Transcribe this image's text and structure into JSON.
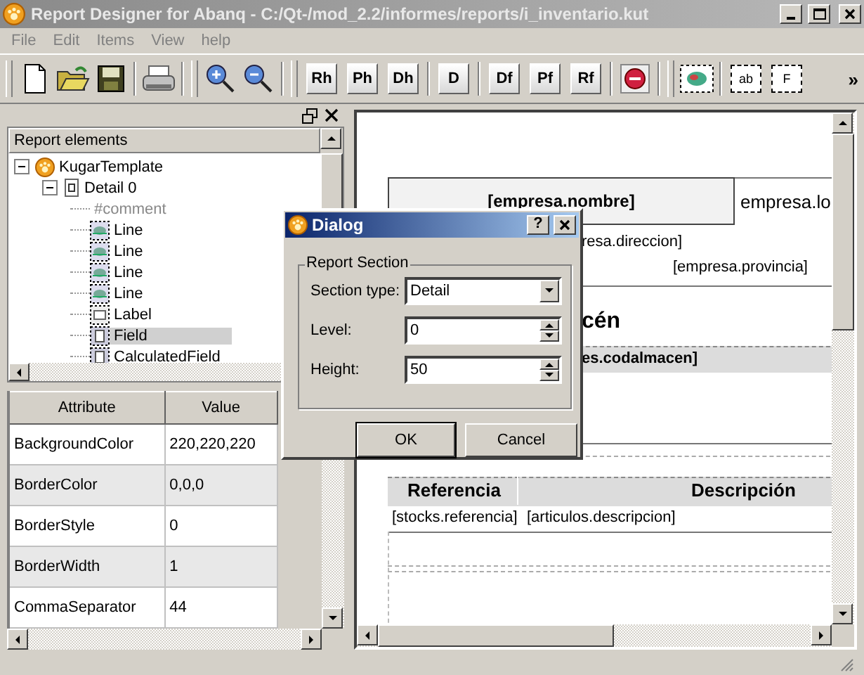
{
  "window": {
    "title": "Report Designer for Abanq - C:/Qt-/mod_2.2/informes/reports/i_inventario.kut"
  },
  "menu": [
    "File",
    "Edit",
    "Items",
    "View",
    "help"
  ],
  "toolbar": {
    "section_groups": [
      [
        "Rh",
        "Ph",
        "Dh"
      ],
      [
        "D"
      ],
      [
        "Df",
        "Pf",
        "Rf"
      ]
    ],
    "item_buttons": [
      "ab",
      "F"
    ],
    "overflow": "»"
  },
  "tree": {
    "header": "Report elements",
    "items": [
      {
        "label": "KugarTemplate",
        "kind": "template",
        "expanded": true,
        "selected": false,
        "children": [
          {
            "label": "Detail 0",
            "kind": "section",
            "expanded": true,
            "selected": false,
            "children": [
              {
                "label": "#comment",
                "kind": "comment",
                "selected": false
              },
              {
                "label": "Line",
                "kind": "line",
                "selected": false
              },
              {
                "label": "Line",
                "kind": "line",
                "selected": false
              },
              {
                "label": "Line",
                "kind": "line",
                "selected": false
              },
              {
                "label": "Line",
                "kind": "line",
                "selected": false
              },
              {
                "label": "Label",
                "kind": "label",
                "selected": false
              },
              {
                "label": "Field",
                "kind": "field",
                "selected": true
              },
              {
                "label": "CalculatedField",
                "kind": "field",
                "selected": false
              }
            ]
          }
        ]
      }
    ]
  },
  "attributes": {
    "columns": [
      "Attribute",
      "Value"
    ],
    "rows": [
      [
        "BackgroundColor",
        "220,220,220"
      ],
      [
        "BorderColor",
        "0,0,0"
      ],
      [
        "BorderStyle",
        "0"
      ],
      [
        "BorderWidth",
        "1"
      ],
      [
        "CommaSeparator",
        "44"
      ]
    ]
  },
  "canvas": {
    "title_field": "[empresa.nombre]",
    "logo_field": "empresa.lo",
    "address_field": "resa.direccion]",
    "province_field": "[empresa.provincia]",
    "heading_fragment": "cén",
    "group_field": "es.codalmacen]",
    "table_header": [
      "Referencia",
      "Descripción"
    ],
    "table_row": [
      "[stocks.referencia]",
      "[articulos.descripcion]"
    ]
  },
  "dialog": {
    "title": "Dialog",
    "help": "?",
    "group": "Report Section",
    "fields": [
      {
        "label": "Section type:",
        "value": "Detail",
        "kind": "combo"
      },
      {
        "label": "Level:",
        "value": "0",
        "kind": "spin"
      },
      {
        "label": "Height:",
        "value": "50",
        "kind": "spin"
      }
    ],
    "buttons": [
      "OK",
      "Cancel"
    ]
  }
}
